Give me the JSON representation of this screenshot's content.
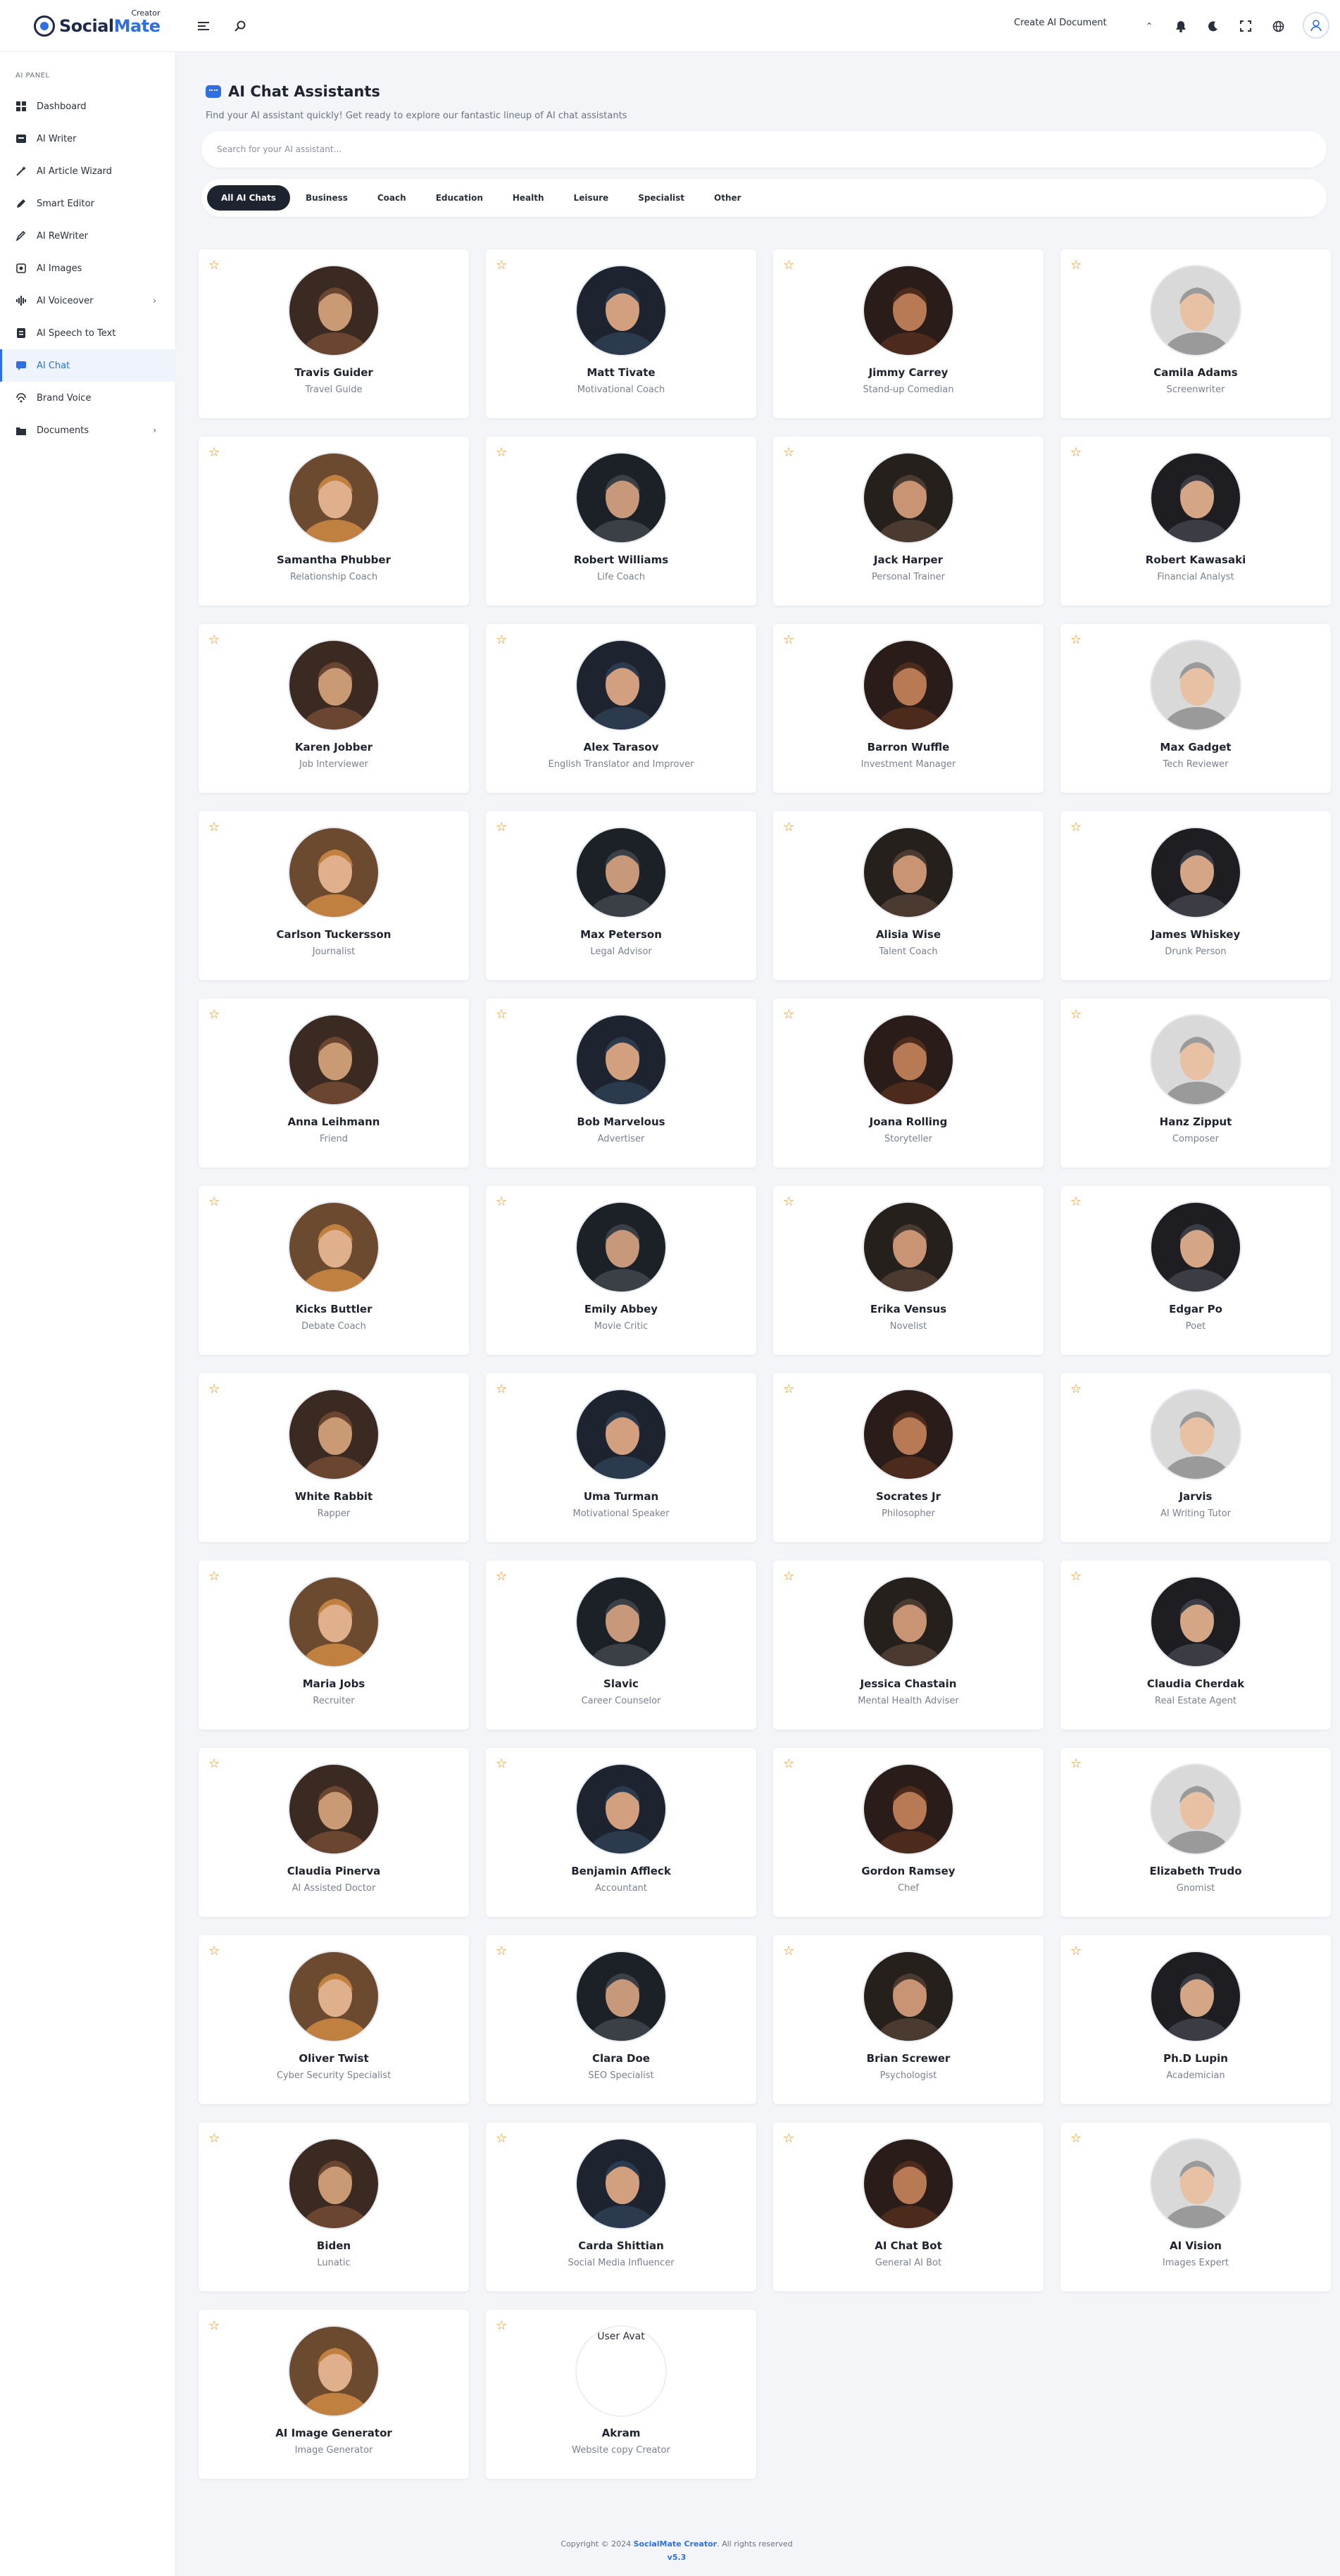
{
  "header": {
    "brand_left": "Social",
    "brand_right": "Mate",
    "brand_sub": "Creator",
    "create_document": "Create AI Document"
  },
  "sidebar": {
    "panel_title": "AI PANEL",
    "items": [
      {
        "label": "Dashboard",
        "icon": "dashboard-icon"
      },
      {
        "label": "AI Writer",
        "icon": "writer-icon"
      },
      {
        "label": "AI Article Wizard",
        "icon": "wizard-icon"
      },
      {
        "label": "Smart Editor",
        "icon": "editor-icon"
      },
      {
        "label": "AI ReWriter",
        "icon": "rewriter-icon"
      },
      {
        "label": "AI Images",
        "icon": "images-icon"
      },
      {
        "label": "AI Voiceover",
        "icon": "voiceover-icon"
      },
      {
        "label": "AI Speech to Text",
        "icon": "speech-icon"
      },
      {
        "label": "AI Chat",
        "icon": "chat-icon"
      },
      {
        "label": "Brand Voice",
        "icon": "brand-icon"
      },
      {
        "label": "Documents",
        "icon": "documents-icon"
      }
    ]
  },
  "main": {
    "title": "AI Chat Assistants",
    "subtitle": "Find your AI assistant quickly! Get ready to explore our fantastic lineup of AI chat assistants",
    "search_placeholder": "Search for your AI assistant...",
    "filters": [
      "All AI Chats",
      "Business",
      "Coach",
      "Education",
      "Health",
      "Leisure",
      "Specialist",
      "Other"
    ],
    "active_filter": "All AI Chats",
    "assistants": [
      {
        "name": "Travis Guider",
        "role": "Travel Guide"
      },
      {
        "name": "Matt Tivate",
        "role": "Motivational Coach"
      },
      {
        "name": "Jimmy Carrey",
        "role": "Stand-up Comedian"
      },
      {
        "name": "Camila Adams",
        "role": "Screenwriter"
      },
      {
        "name": "Samantha Phubber",
        "role": "Relationship Coach"
      },
      {
        "name": "Robert Williams",
        "role": "Life Coach"
      },
      {
        "name": "Jack Harper",
        "role": "Personal Trainer"
      },
      {
        "name": "Robert Kawasaki",
        "role": "Financial Analyst"
      },
      {
        "name": "Karen Jobber",
        "role": "Job Interviewer"
      },
      {
        "name": "Alex Tarasov",
        "role": "English Translator and Improver"
      },
      {
        "name": "Barron Wuffle",
        "role": "Investment Manager"
      },
      {
        "name": "Max Gadget",
        "role": "Tech Reviewer"
      },
      {
        "name": "Carlson Tuckersson",
        "role": "Journalist"
      },
      {
        "name": "Max Peterson",
        "role": "Legal Advisor"
      },
      {
        "name": "Alisia Wise",
        "role": "Talent Coach"
      },
      {
        "name": "James Whiskey",
        "role": "Drunk Person"
      },
      {
        "name": "Anna Leihmann",
        "role": "Friend"
      },
      {
        "name": "Bob Marvelous",
        "role": "Advertiser"
      },
      {
        "name": "Joana Rolling",
        "role": "Storyteller"
      },
      {
        "name": "Hanz Zipput",
        "role": "Composer"
      },
      {
        "name": "Kicks Buttler",
        "role": "Debate Coach"
      },
      {
        "name": "Emily Abbey",
        "role": "Movie Critic"
      },
      {
        "name": "Erika Vensus",
        "role": "Novelist"
      },
      {
        "name": "Edgar Po",
        "role": "Poet"
      },
      {
        "name": "White Rabbit",
        "role": "Rapper"
      },
      {
        "name": "Uma Turman",
        "role": "Motivational Speaker"
      },
      {
        "name": "Socrates Jr",
        "role": "Philosopher"
      },
      {
        "name": "Jarvis",
        "role": "AI Writing Tutor"
      },
      {
        "name": "Maria Jobs",
        "role": "Recruiter"
      },
      {
        "name": "Slavic",
        "role": "Career Counselor"
      },
      {
        "name": "Jessica Chastain",
        "role": "Mental Health Adviser"
      },
      {
        "name": "Claudia Cherdak",
        "role": "Real Estate Agent"
      },
      {
        "name": "Claudia Pinerva",
        "role": "AI Assisted Doctor"
      },
      {
        "name": "Benjamin Affleck",
        "role": "Accountant"
      },
      {
        "name": "Gordon Ramsey",
        "role": "Chef"
      },
      {
        "name": "Elizabeth Trudo",
        "role": "Gnomist"
      },
      {
        "name": "Oliver Twist",
        "role": "Cyber Security Specialist"
      },
      {
        "name": "Clara Doe",
        "role": "SEO Specialist"
      },
      {
        "name": "Brian Screwer",
        "role": "Psychologist"
      },
      {
        "name": "Ph.D Lupin",
        "role": "Academician"
      },
      {
        "name": "Biden",
        "role": "Lunatic"
      },
      {
        "name": "Carda Shittian",
        "role": "Social Media Influencer"
      },
      {
        "name": "AI Chat Bot",
        "role": "General AI Bot"
      },
      {
        "name": "AI Vision",
        "role": "Images Expert"
      },
      {
        "name": "AI Image Generator",
        "role": "Image Generator"
      },
      {
        "name": "Akram",
        "role": "Website copy Creator",
        "avatar_alt": "User Avat"
      }
    ]
  },
  "footer": {
    "copyright_prefix": "Copyright © 2024 ",
    "brand": "SocialMate Creator",
    "copyright_suffix": ". All rights reserved",
    "version": "v5.3"
  },
  "colors": {
    "accent": "#2f6fe0",
    "star": "#f08c1a",
    "active_filter_bg": "#1e2330"
  }
}
